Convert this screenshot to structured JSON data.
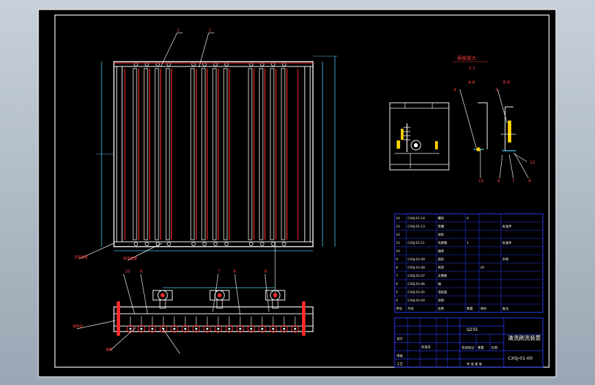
{
  "colors": {
    "background": "#000000",
    "frame": "#ffffff",
    "table_lines": "#2a3cff",
    "tube_red": "#ff2a2a",
    "tube_white": "#ffffff",
    "dimension": "#4fd1ff",
    "label_text": "#ff4040",
    "leader": "#ffffff",
    "title_text": "#ffffff",
    "table_text": "#ffffff"
  },
  "views": {
    "detail_title": "局部放大",
    "detail_scale": "2:1",
    "section_a": "A-A",
    "section_b": "B-B",
    "callouts_top": [
      "1",
      "2"
    ],
    "callouts_front": [
      "10",
      "6",
      "7",
      "8",
      "9"
    ],
    "callouts_detail": [
      "4",
      "5",
      "12",
      "15",
      "6",
      "7",
      "8"
    ]
  },
  "title_block": {
    "drawing_name": "清洗刷洗装置",
    "drawing_number": "CXSJ-01-00",
    "approval_label": "审核",
    "process_label": "工艺",
    "designer_label": "设计",
    "scale_label": "比例",
    "weight_label": "重量",
    "stage_label": "阶段标记",
    "sheet_label": "共 张 第 张",
    "standardization_label": "标准化",
    "material_label": "Q235"
  },
  "bom": {
    "headers": [
      "序号",
      "代号",
      "名称",
      "数量",
      "材料",
      "备注"
    ],
    "rows": [
      [
        "14",
        "CXSJ-01-14",
        "螺栓",
        "4",
        "",
        ""
      ],
      [
        "13",
        "CXSJ-01-13",
        "垫圈",
        "",
        "",
        "标准件"
      ],
      [
        "12",
        "",
        "滚轮",
        "",
        "",
        ""
      ],
      [
        "11",
        "CXSJ-01-11",
        "毛刷辊",
        "1",
        "",
        "标准件"
      ],
      [
        "10",
        "",
        "轴承",
        "",
        "",
        ""
      ],
      [
        "9",
        "CXSJ-01-09",
        "链轮",
        "",
        "",
        "外购"
      ],
      [
        "8",
        "CXSJ-01-08",
        "机架",
        "",
        "45",
        ""
      ],
      [
        "7",
        "CXSJ-01-07",
        "支撑板",
        "",
        "",
        ""
      ],
      [
        "6",
        "CXSJ-01-06",
        "轴",
        "",
        "",
        ""
      ],
      [
        "5",
        "CXSJ-01-05",
        "电机座",
        "",
        "",
        ""
      ],
      [
        "4",
        "CXSJ-01-04",
        "滚筒",
        "",
        "",
        ""
      ]
    ]
  },
  "notes": {
    "top_left_a": "清洗装置",
    "top_left_b": "刷洗装置",
    "front_left_a": "链传动",
    "front_left_b": "滚筒"
  }
}
